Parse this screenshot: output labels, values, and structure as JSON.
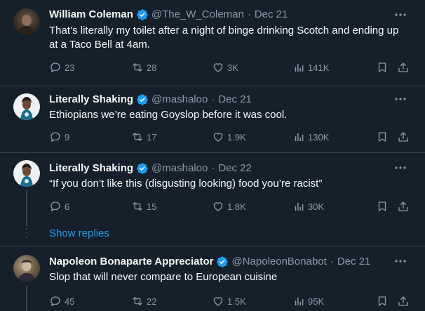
{
  "tweets": [
    {
      "name": "William Coleman",
      "handle": "@The_W_Coleman",
      "date": "Dec 21",
      "text": "That’s literally my toilet after a night of binge drinking Scotch and ending up at a Taco Bell at 4am.",
      "replies": "23",
      "retweets": "28",
      "likes": "3K",
      "views": "141K"
    },
    {
      "name": "Literally Shaking",
      "handle": "@mashaloo",
      "date": "Dec 21",
      "text": "Ethiopians we’re eating Goyslop before it was cool.",
      "replies": "9",
      "retweets": "17",
      "likes": "1.9K",
      "views": "130K"
    },
    {
      "name": "Literally Shaking",
      "handle": "@mashaloo",
      "date": "Dec 22",
      "text": "“If you don’t like this (disgusting looking) food you’re racist”",
      "replies": "6",
      "retweets": "15",
      "likes": "1.8K",
      "views": "30K"
    },
    {
      "name": "Napoleon Bonaparte Appreciator",
      "handle": "@NapoleonBonabot",
      "date": "Dec 21",
      "text": "Slop that will never compare to European cuisine",
      "replies": "45",
      "retweets": "22",
      "likes": "1.5K",
      "views": "95K"
    }
  ],
  "show_replies": "Show replies",
  "colors": {
    "background": "#15202b",
    "accent": "#1d9bf0",
    "muted": "#8b98a5",
    "border": "#38444d"
  },
  "icons": [
    "verified-badge-icon",
    "more-icon",
    "reply-icon",
    "retweet-icon",
    "like-icon",
    "views-icon",
    "bookmark-icon",
    "share-icon"
  ]
}
